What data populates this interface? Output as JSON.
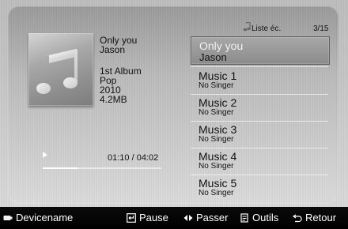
{
  "now_playing": {
    "title": "Only you",
    "artist": "Jason",
    "album": "1st Album",
    "genre": "Pop",
    "year": "2010",
    "size": "4.2MB",
    "time": "01:10 / 04:02",
    "progress_fraction": 0.29
  },
  "playlist": {
    "header_label": "Liste éc.",
    "position": "3/15",
    "items": [
      {
        "title": "Only you",
        "subtitle": "Jason"
      },
      {
        "title": "Music 1",
        "subtitle": "No Singer"
      },
      {
        "title": "Music 2",
        "subtitle": "No Singer"
      },
      {
        "title": "Music 3",
        "subtitle": "No Singer"
      },
      {
        "title": "Music 4",
        "subtitle": "No Singer"
      },
      {
        "title": "Music 5",
        "subtitle": "No Singer"
      }
    ]
  },
  "bottom_bar": {
    "device": "Devicename",
    "pause": "Pause",
    "skip": "Passer",
    "tools": "Outils",
    "back": "Retour"
  },
  "icons": {
    "device": "device-icon",
    "pause": "enter-icon",
    "skip": "left-right-arrows-icon",
    "tools": "tools-icon",
    "back": "return-icon",
    "playlist": "music-note-icon"
  }
}
